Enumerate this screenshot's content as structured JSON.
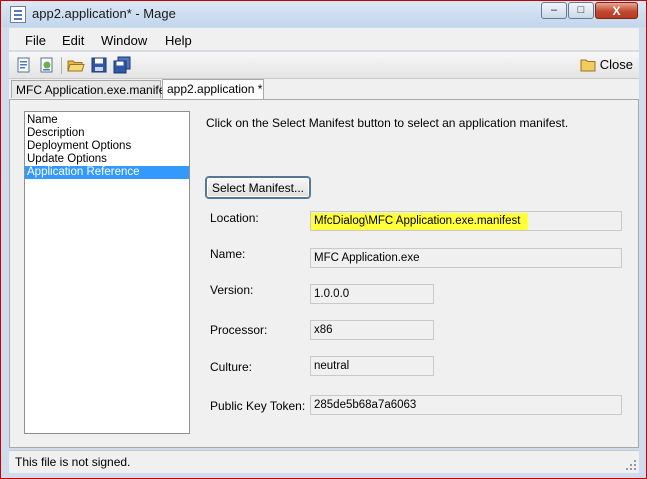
{
  "window": {
    "title": "app2.application* - Mage"
  },
  "caption": {
    "minimize": "–",
    "maximize": "□",
    "close": "X"
  },
  "menu": [
    "File",
    "Edit",
    "Window",
    "Help"
  ],
  "toolbar": {
    "close_label": "Close"
  },
  "tabs": [
    {
      "label": "MFC Application.exe.manifest",
      "active": false
    },
    {
      "label": "app2.application *",
      "active": true
    }
  ],
  "nav": {
    "items": [
      "Name",
      "Description",
      "Deployment Options",
      "Update Options",
      "Application Reference"
    ],
    "selected": "Application Reference"
  },
  "instruction": "Click on the Select Manifest button to select an application manifest.",
  "select_button": "Select Manifest...",
  "fields": {
    "location": {
      "label": "Location:",
      "value": "MfcDialog\\MFC Application.exe.manifest"
    },
    "name": {
      "label": "Name:",
      "value": "MFC Application.exe"
    },
    "version": {
      "label": "Version:",
      "value": "1.0.0.0"
    },
    "processor": {
      "label": "Processor:",
      "value": "x86"
    },
    "culture": {
      "label": "Culture:",
      "value": "neutral"
    },
    "public_key_token": {
      "label": "Public Key Token:",
      "value": "285de5b68a7a6063"
    }
  },
  "status": "This file is not signed.",
  "colors": {
    "selection": "#3399ff",
    "highlight": "#ffff3a",
    "titlebar": "#c3d6ec"
  },
  "icons": [
    "new-document-icon",
    "new-application-icon",
    "open-folder-icon",
    "save-icon",
    "save-all-icon",
    "close-folder-icon"
  ]
}
